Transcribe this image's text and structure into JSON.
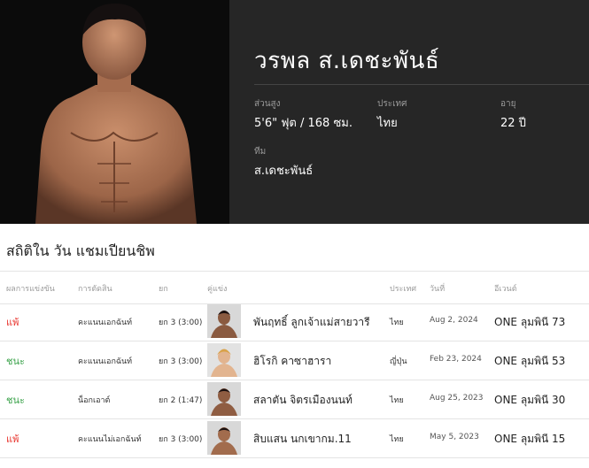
{
  "fighter": {
    "name": "วรพล ส.เดชะพันธ์",
    "stats": [
      {
        "label": "ส่วนสูง",
        "value": "5'6\" ฟุต / 168 ซม."
      },
      {
        "label": "ประเทศ",
        "value": "ไทย"
      },
      {
        "label": "อายุ",
        "value": "22 ปี"
      },
      {
        "label": "ทีม",
        "value": "ส.เดชะพันธ์"
      }
    ]
  },
  "record": {
    "title": "สถิติใน วัน แชมเปียนชิพ",
    "headers": [
      "ผลการแข่งขัน",
      "การตัดสิน",
      "ยก",
      "คู่แข่ง",
      "ประเทศ",
      "วันที่",
      "อีเวนต์"
    ],
    "rows": [
      {
        "result": "แพ้",
        "method": "คะแนนเอกฉันท์",
        "round": "ยก 3 (3:00)",
        "opponent": "พันฤทธิ์ ลูกเจ้าแม่สายวารี",
        "country": "ไทย",
        "date": "Aug 2, 2024",
        "event": "ONE ลุมพินี 73"
      },
      {
        "result": "ชนะ",
        "method": "คะแนนเอกฉันท์",
        "round": "ยก 3 (3:00)",
        "opponent": "ฮิโรกิ คาซาฮารา",
        "country": "ญี่ปุ่น",
        "date": "Feb 23, 2024",
        "event": "ONE ลุมพินี 53"
      },
      {
        "result": "ชนะ",
        "method": "น็อกเอาต์",
        "round": "ยก 2 (1:47)",
        "opponent": "สลาตัน จิตรเมืองนนท์",
        "country": "ไทย",
        "date": "Aug 25, 2023",
        "event": "ONE ลุมพินี 30"
      },
      {
        "result": "แพ้",
        "method": "คะแนนไม่เอกฉันท์",
        "round": "ยก 3 (3:00)",
        "opponent": "สิบแสน นกเขากม.11",
        "country": "ไทย",
        "date": "May 5, 2023",
        "event": "ONE ลุมพินี 15"
      }
    ]
  },
  "colors": {
    "loss": "#e8322b",
    "win": "#3aa24a",
    "panel": "#262626",
    "hero_bg": "#0b0b0b"
  }
}
